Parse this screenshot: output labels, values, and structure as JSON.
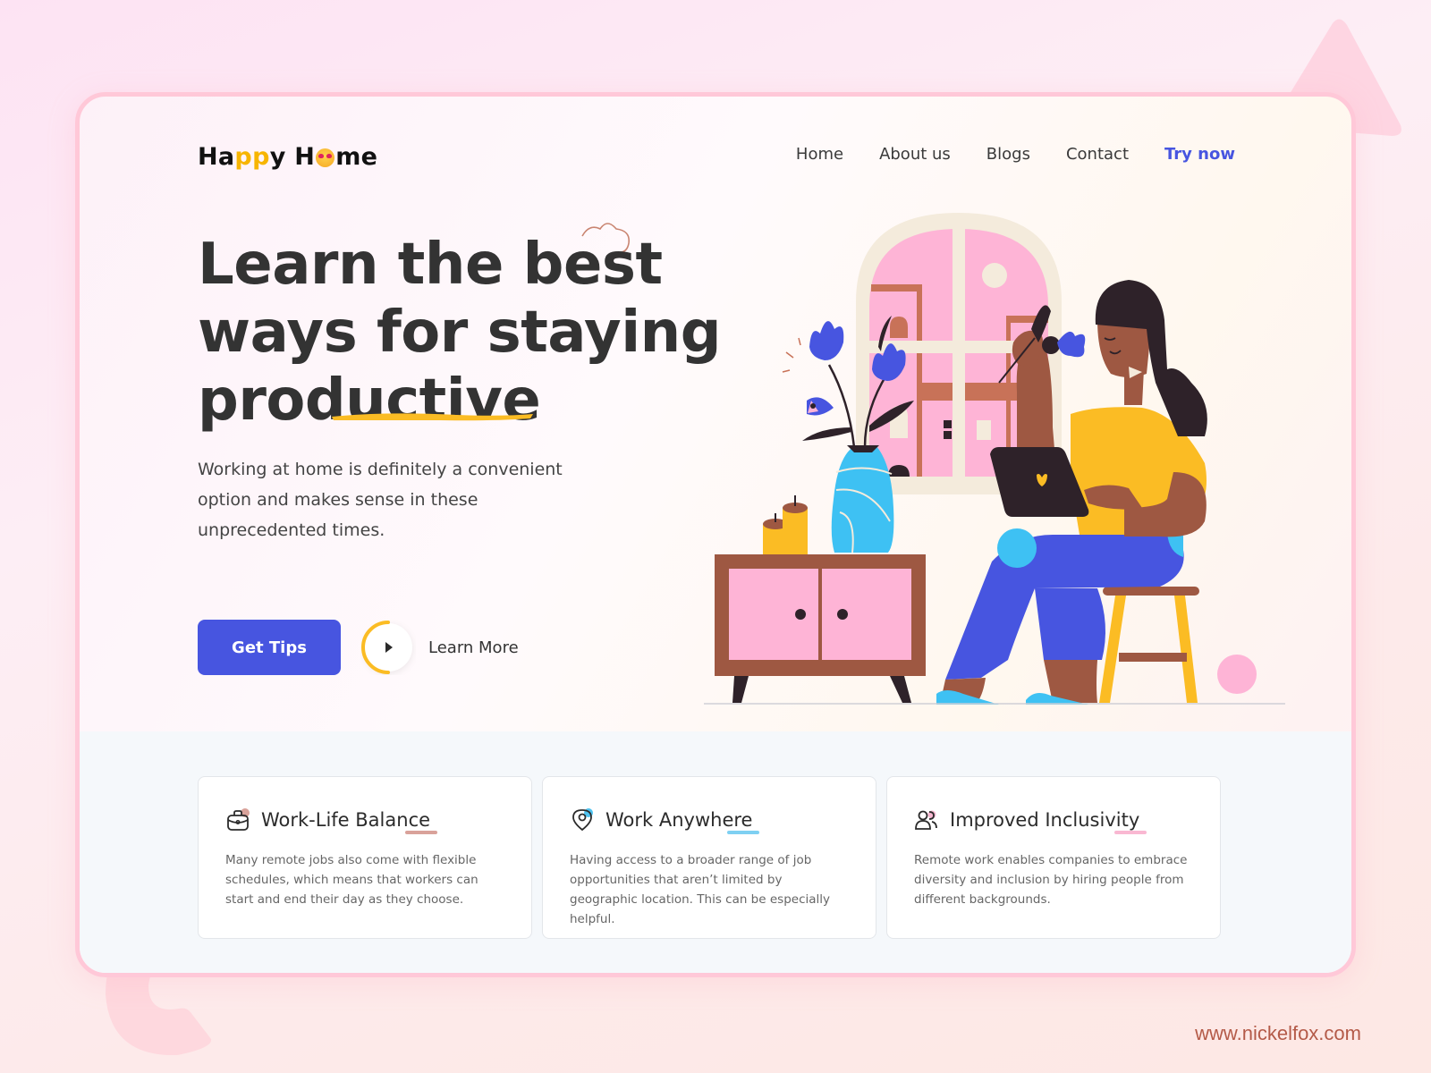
{
  "brand": {
    "logo_part1": "Ha",
    "logo_p1": "p",
    "logo_p2": "p",
    "logo_part2": "y H",
    "logo_part3": "me"
  },
  "nav": {
    "items": [
      {
        "label": "Home"
      },
      {
        "label": "About us"
      },
      {
        "label": "Blogs"
      },
      {
        "label": "Contact"
      }
    ],
    "cta": "Try now"
  },
  "hero": {
    "headline_lines": [
      "Learn the best",
      "ways for staying",
      "productive"
    ],
    "subtext": "Working at home is definitely a convenient option and makes sense in these unprecedented times.",
    "primary_button": "Get Tips",
    "secondary_button": "Learn More"
  },
  "features": [
    {
      "icon": "briefcase-icon",
      "title": "Work-Life Balance",
      "accent_color": "#d9a29a",
      "description": "Many remote jobs also come with flexible schedules, which means that workers can start and end their day as they choose."
    },
    {
      "icon": "location-pin-icon",
      "title": "Work Anywhere",
      "accent_color": "#7ed0f2",
      "description": "Having access to a broader range of job opportunities that aren’t limited by geographic location. This can be especially helpful."
    },
    {
      "icon": "users-icon",
      "title": "Improved Inclusivity",
      "accent_color": "#f9b8d2",
      "description": "Remote work enables companies to embrace diversity and inclusion by hiring people from different backgrounds."
    }
  ],
  "watermark": "www.nickelfox.com",
  "colors": {
    "primary": "#4755e0",
    "accent_yellow": "#fbbc24",
    "frame_border": "#ffc8d8",
    "text_dark": "#333333"
  }
}
